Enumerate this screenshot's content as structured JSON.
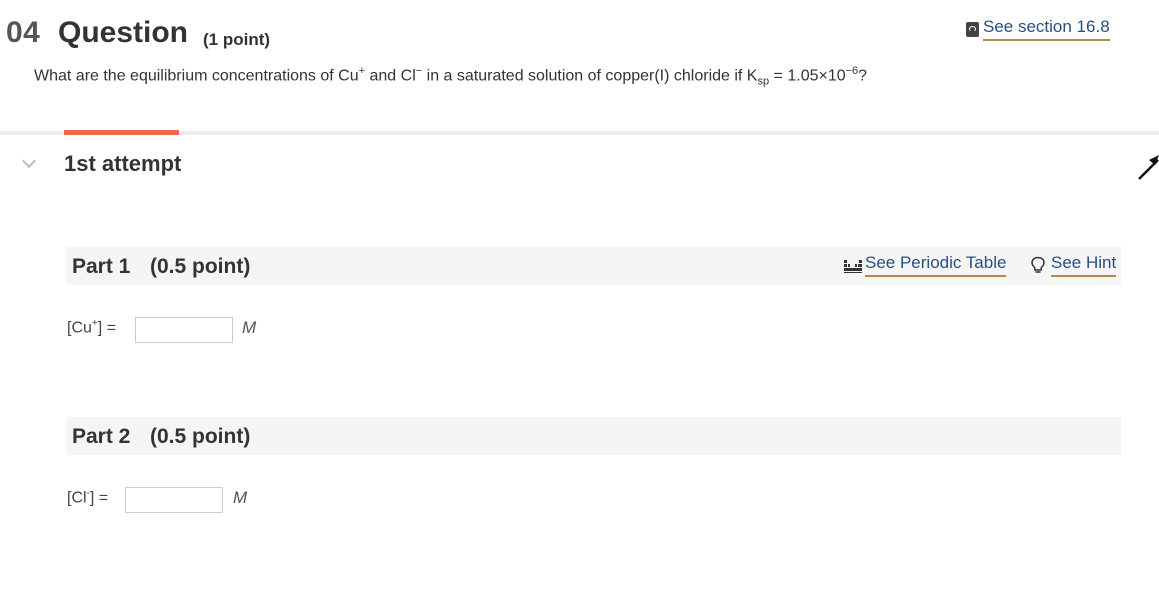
{
  "question": {
    "number": "04",
    "title": "Question",
    "points": "(1 point)",
    "text_before": "What are the equilibrium concentrations of Cu",
    "cu_charge": "+",
    "text_and": " and Cl",
    "cl_charge": "−",
    "text_mid": " in a saturated solution of copper(I) chloride if K",
    "ksp_sub": "sp",
    "text_ksp": " = 1.05×10",
    "ksp_exp": "−6",
    "text_end": "?"
  },
  "header": {
    "section_link": "See section 16.8",
    "section_icon": "book-icon"
  },
  "attempt": {
    "label": "1st attempt",
    "accent_color": "#e8694a"
  },
  "part1": {
    "title": "Part 1",
    "points": "(0.5 point)",
    "periodic_table_link": "See Periodic Table",
    "hint_link": "See Hint",
    "label_before": "[Cu",
    "label_charge": "+",
    "label_after": "] =",
    "value": "",
    "unit": "M"
  },
  "part2": {
    "title": "Part 2",
    "points": "(0.5 point)",
    "label_before": "[Cl",
    "label_charge": "-",
    "label_after": "] =",
    "value": "",
    "unit": "M"
  }
}
